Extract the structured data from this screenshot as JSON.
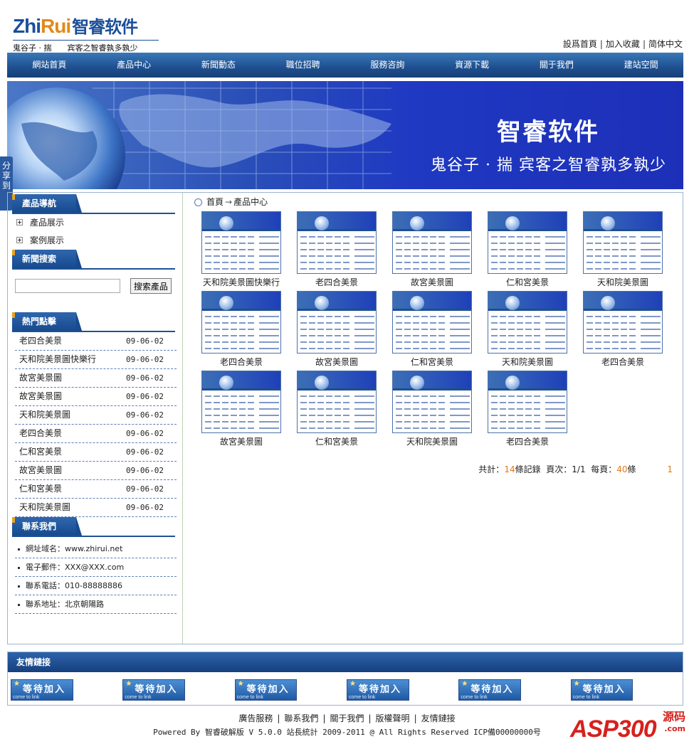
{
  "logo": {
    "en_a": "Zhi",
    "en_b": "Rui",
    "cn": "智睿软件",
    "slogan": "鬼谷子 · 揣　　宾客之智睿孰多孰少"
  },
  "toplinks": [
    "設爲首頁",
    "加入收藏",
    "简体中文"
  ],
  "nav": [
    "網站首頁",
    "產品中心",
    "新聞動态",
    "職位招聘",
    "服務咨詢",
    "資源下載",
    "關于我們",
    "建站空間"
  ],
  "banner": {
    "title": "智睿软件",
    "slogan": "鬼谷子 · 揣  宾客之智睿孰多孰少"
  },
  "share": "分享到",
  "sidebar": {
    "product_nav": {
      "title": "產品導航",
      "items": [
        "產品展示",
        "案例展示"
      ]
    },
    "news_search": {
      "title": "新聞搜索",
      "button": "搜索產品",
      "placeholder": ""
    },
    "hot": {
      "title": "熱門點擊",
      "items": [
        {
          "name": "老四合美景",
          "date": "09-06-02"
        },
        {
          "name": "天和院美景圖快樂行",
          "date": "09-06-02"
        },
        {
          "name": "故宮美景圖",
          "date": "09-06-02"
        },
        {
          "name": "故宮美景圖",
          "date": "09-06-02"
        },
        {
          "name": "天和院美景圖",
          "date": "09-06-02"
        },
        {
          "name": "老四合美景",
          "date": "09-06-02"
        },
        {
          "name": "仁和宮美景",
          "date": "09-06-02"
        },
        {
          "name": "故宮美景圖",
          "date": "09-06-02"
        },
        {
          "name": "仁和宮美景",
          "date": "09-06-02"
        },
        {
          "name": "天和院美景圖",
          "date": "09-06-02"
        }
      ]
    },
    "contact": {
      "title": "聯系我們",
      "items": [
        "網址域名：www.zhirui.net",
        "電子郵件：XXX@XXX.com",
        "聯系電話：010-88888886",
        "聯系地址：北京朝陽路"
      ]
    }
  },
  "breadcrumb": {
    "home": "首頁",
    "arrow": "→",
    "current": "產品中心"
  },
  "products": [
    "天和院美景圖快樂行",
    "老四合美景",
    "故宮美景圖",
    "仁和宮美景",
    "天和院美景圖",
    "老四合美景",
    "故宮美景圖",
    "仁和宮美景",
    "天和院美景圖",
    "老四合美景",
    "故宮美景圖",
    "仁和宮美景",
    "天和院美景圖",
    "老四合美景"
  ],
  "pager": {
    "total_label": "共計：",
    "total": "14",
    "total_unit": "條記錄",
    "page_label": "頁次：",
    "page": "1/1",
    "per_label": "每頁：",
    "per": "40",
    "per_unit": "條",
    "current": "1"
  },
  "friend": {
    "title": "友情鏈接",
    "link_text": "等待加入",
    "link_sub": "come to link",
    "count": 6
  },
  "footer": {
    "links": [
      "廣告服務",
      "聯系我們",
      "關于我們",
      "版權聲明",
      "友情鏈接"
    ],
    "copyright": "Powered By 智睿破解版 V 5.0.0 站長統計 2009-2011 @ All Rights Reserved ICP備00000000号"
  },
  "watermark": {
    "big": "ASP300",
    "cn": "源码",
    "com": ".com"
  }
}
